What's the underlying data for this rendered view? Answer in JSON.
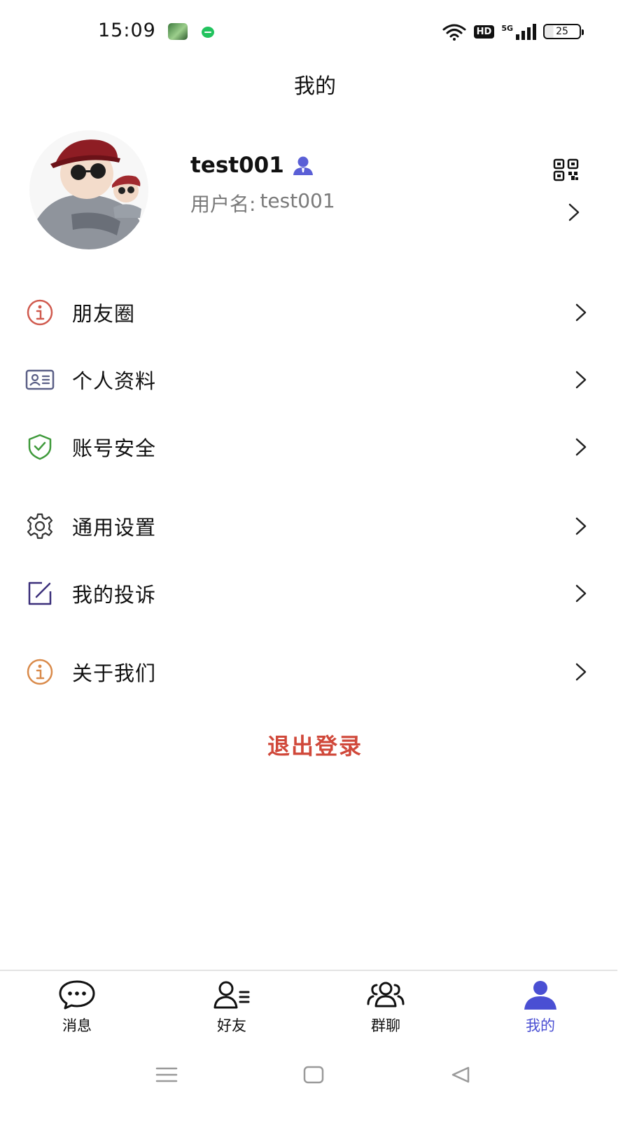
{
  "status_bar": {
    "time": "15:09",
    "network_badge": "HD",
    "signal_label": "5G",
    "battery_level": "25"
  },
  "header": {
    "title": "我的"
  },
  "profile": {
    "display_name": "test001",
    "username_label": "用户名:",
    "username_value": "test001"
  },
  "menu": {
    "items": [
      {
        "label": "朋友圈",
        "icon": "info-circle-icon",
        "color": "#d05a4e"
      },
      {
        "label": "个人资料",
        "icon": "id-card-icon",
        "color": "#5a5f86"
      },
      {
        "label": "账号安全",
        "icon": "shield-check-icon",
        "color": "#3f9a3b"
      },
      {
        "label": "通用设置",
        "icon": "gear-icon",
        "color": "#333333"
      },
      {
        "label": "我的投诉",
        "icon": "edit-square-icon",
        "color": "#3b2f7a"
      },
      {
        "label": "关于我们",
        "icon": "info-circle-icon",
        "color": "#d98a4a"
      }
    ]
  },
  "logout": {
    "label": "退出登录",
    "color": "#d0483a"
  },
  "tabbar": {
    "active_color": "#4a4fd3",
    "tabs": [
      {
        "label": "消息",
        "icon": "chat-bubble-icon",
        "active": false
      },
      {
        "label": "好友",
        "icon": "contacts-icon",
        "active": false
      },
      {
        "label": "群聊",
        "icon": "group-icon",
        "active": false
      },
      {
        "label": "我的",
        "icon": "person-icon",
        "active": true
      }
    ]
  }
}
